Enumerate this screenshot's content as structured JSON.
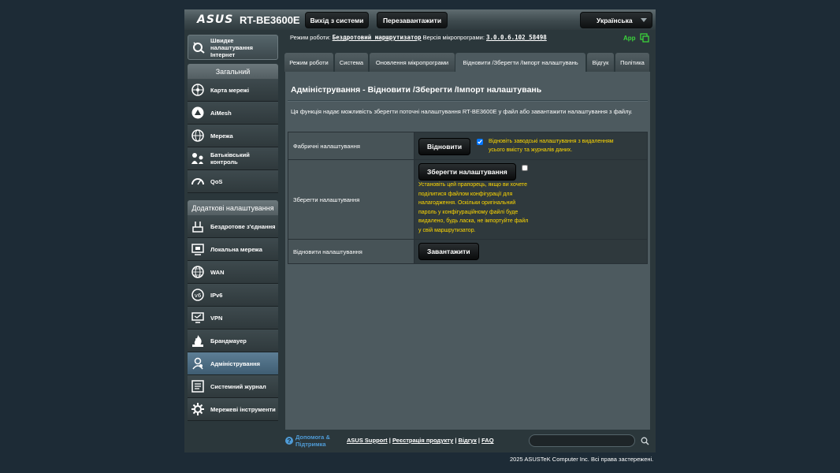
{
  "header": {
    "brand": "ASUS",
    "model": "RT-BE3600E",
    "logout_label": "Вихід з системи",
    "reboot_label": "Перезавантажити",
    "language": "Українська"
  },
  "nav": {
    "quick_setup": "Швидке налаштування Інтернет",
    "general_header": "Загальний",
    "general_items": [
      {
        "label": "Карта мережі",
        "icon": "network-map-icon"
      },
      {
        "label": "AiMesh",
        "icon": "aimesh-icon"
      },
      {
        "label": "Мережа",
        "icon": "guest-network-icon"
      },
      {
        "label": "Батьківський контроль",
        "icon": "parental-control-icon"
      },
      {
        "label": "QoS",
        "icon": "qos-icon"
      }
    ],
    "advanced_header": "Додаткові налаштування",
    "advanced_items": [
      {
        "label": "Бездротове з'єднання",
        "icon": "wireless-icon"
      },
      {
        "label": "Локальна мережа",
        "icon": "lan-icon"
      },
      {
        "label": "WAN",
        "icon": "wan-icon"
      },
      {
        "label": "IPv6",
        "icon": "ipv6-icon"
      },
      {
        "label": "VPN",
        "icon": "vpn-icon"
      },
      {
        "label": "Брандмауер",
        "icon": "firewall-icon"
      },
      {
        "label": "Адміністрування",
        "icon": "administration-icon",
        "active": true
      },
      {
        "label": "Системний журнал",
        "icon": "system-log-icon"
      },
      {
        "label": "Мережеві інструменти",
        "icon": "network-tools-icon"
      }
    ]
  },
  "status": {
    "op_mode_label": "Режим роботи:",
    "op_mode_value": "Бездротовий маршрутизатор",
    "firmware_label": "Версія мікропрограми:",
    "firmware_value": "3.0.0.6.102_58498",
    "app_label": "App"
  },
  "tabs": [
    {
      "label": "Режим роботи"
    },
    {
      "label": "Система"
    },
    {
      "label": "Оновлення мікропрограми"
    },
    {
      "label": "Відновити /Зберегти /Імпорт налаштувань",
      "active": true
    },
    {
      "label": "Відгук"
    },
    {
      "label": "Політика"
    }
  ],
  "panel": {
    "title": "Адміністрування - Відновити /Зберегти /Імпорт налаштувань",
    "description": "Ця функція надає можливість зберегти поточні налаштування RT-BE3600E у файл або завантажити налаштування з файлу.",
    "rows": {
      "factory": {
        "label": "Фабричні налаштування",
        "button": "Відновити",
        "checkbox_checked": true,
        "note": "Відновіть заводські налаштування з видаленням усього вмісту та журналів даних."
      },
      "save": {
        "label": "Зберегти налаштування",
        "button": "Зберегти налаштування",
        "checkbox_checked": false,
        "note": "Установіть цей прапорець, якщо ви хочете поділитися файлом конфігурації для налагодження. Оскільки оригінальний пароль у конфігураційному файлі буде видалено, будь ласка, не імпортуйте файл у свій маршрутизатор."
      },
      "restore": {
        "label": "Відновити налаштування",
        "button": "Завантажити"
      }
    }
  },
  "footer": {
    "help": "Допомога & Підтримка",
    "links": [
      "ASUS Support",
      "Реєстрація продукту",
      "Відгук",
      "FAQ"
    ],
    "search_placeholder": "",
    "copyright": "2025 ASUSTeK Computer Inc. Всі права застережені."
  }
}
